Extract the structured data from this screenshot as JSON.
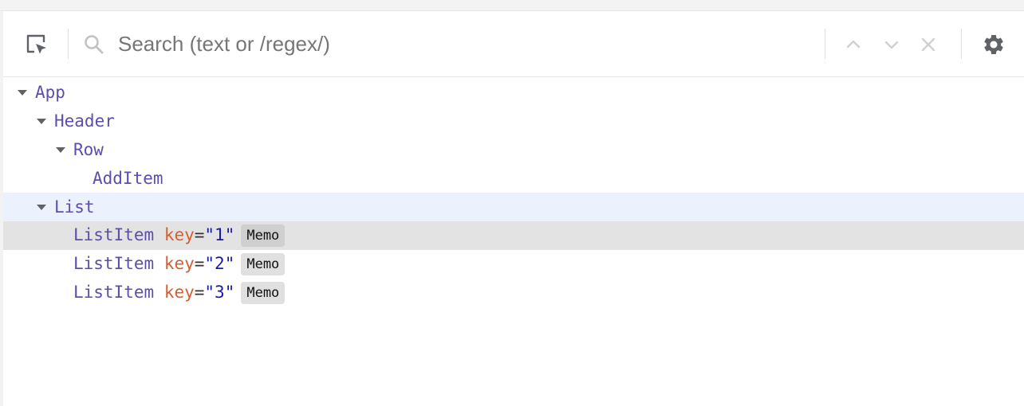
{
  "search": {
    "placeholder": "Search (text or /regex/)",
    "value": ""
  },
  "tree": {
    "rows": [
      {
        "name": "App",
        "expanded": true
      },
      {
        "name": "Header",
        "expanded": true
      },
      {
        "name": "Row",
        "expanded": true
      },
      {
        "name": "AddItem"
      },
      {
        "name": "List",
        "expanded": true,
        "state": "hovered"
      },
      {
        "name": "ListItem",
        "key_attr": "key",
        "key_value": "\"1\"",
        "badge": "Memo",
        "state": "selected"
      },
      {
        "name": "ListItem",
        "key_attr": "key",
        "key_value": "\"2\"",
        "badge": "Memo"
      },
      {
        "name": "ListItem",
        "key_attr": "key",
        "key_value": "\"3\"",
        "badge": "Memo"
      }
    ]
  },
  "icons": {
    "inspect": "inspect-element-icon",
    "search": "search-icon",
    "prev": "chevron-up-icon",
    "next": "chevron-down-icon",
    "clear": "close-icon",
    "settings": "gear-icon"
  },
  "colors": {
    "component_name": "#5d4ea9",
    "attr_name": "#d55f31",
    "attr_value": "#1a1aa6",
    "hover_row": "#ebf2fd",
    "selected_row": "#e3e3e3"
  }
}
